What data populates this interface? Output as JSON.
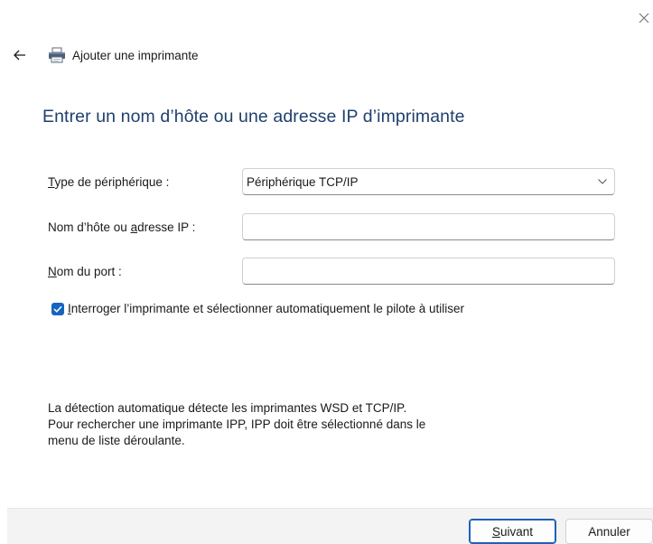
{
  "window": {
    "close_icon": "close-icon"
  },
  "header": {
    "back_icon": "back-arrow-icon",
    "printer_icon": "printer-icon",
    "title": "Ajouter une imprimante"
  },
  "page": {
    "title": "Entrer un nom d’hôte ou une adresse IP d’imprimante"
  },
  "form": {
    "device_type": {
      "label_access": "T",
      "label_rest": "ype de périphérique :",
      "value": "Périphérique TCP/IP"
    },
    "hostname": {
      "label_before": "Nom d’hôte ou ",
      "label_access": "a",
      "label_after": "dresse IP :",
      "value": ""
    },
    "port": {
      "label_access": "N",
      "label_rest": "om du port :",
      "value": ""
    },
    "auto_driver": {
      "checked": true,
      "label_access": "I",
      "label_rest": "nterroger l’imprimante et sélectionner automatiquement le pilote à utiliser"
    }
  },
  "info": {
    "line1": "La détection automatique détecte les imprimantes WSD et TCP/IP.",
    "line2": "Pour rechercher une imprimante IPP, IPP doit être sélectionné dans le",
    "line3": "menu de liste déroulante."
  },
  "footer": {
    "next_access": "S",
    "next_rest": "uivant",
    "cancel_label": "Annuler"
  },
  "colors": {
    "title": "#1f3f6e",
    "accent": "#1565c0",
    "footer_bg": "#f3f3f3"
  }
}
